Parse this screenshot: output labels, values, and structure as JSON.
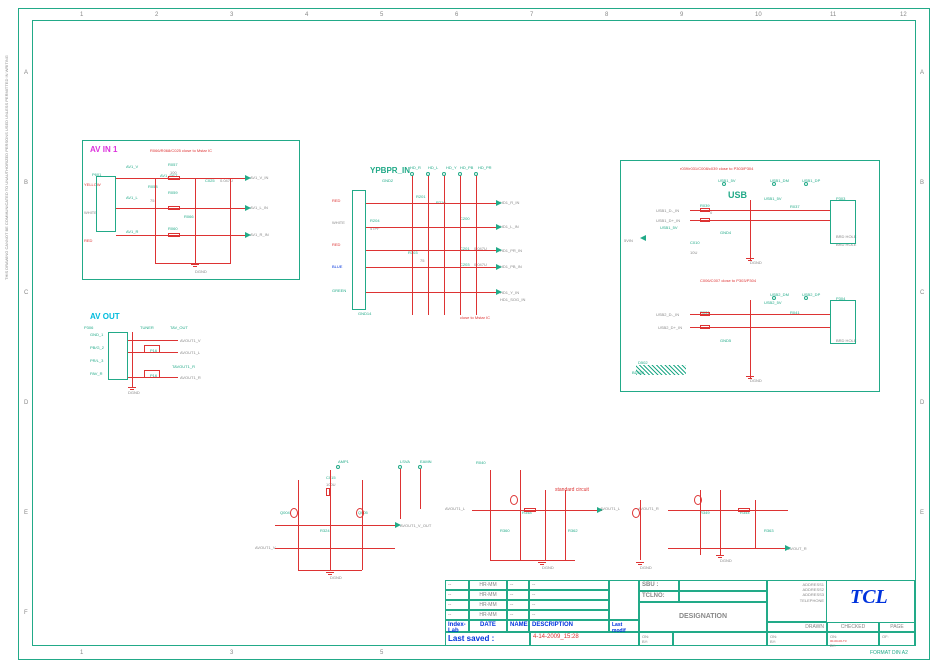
{
  "format": "FORMAT DIN A2",
  "side_notice": "THIS DRAWING CANNOT BE COMMUNICATED TO UNAUTHORIZED PERSONS USED UNLESS PERMITTED IN WRITING",
  "ruler_top": {
    "1": "1",
    "2": "2",
    "3": "3",
    "4": "4",
    "5": "5",
    "6": "6",
    "7": "7",
    "8": "8",
    "9": "9",
    "10": "10",
    "11": "11",
    "12": "12"
  },
  "ruler_side": {
    "A": "A",
    "B": "B",
    "C": "C",
    "D": "D",
    "E": "E",
    "F": "F"
  },
  "blocks": {
    "avin": {
      "title": "AV IN 1",
      "note": "R066/R068/C025 close to Mstar IC",
      "yellow": "YELLOW",
      "white": "WHITE",
      "red": "RED",
      "av1_v": "AV1_V",
      "av1_l": "AV1_L",
      "av1_r": "AV1_R",
      "sig_v": "AV1_V_IN",
      "sig_l": "AV1_L_IN",
      "sig_r": "AV1_R_IN",
      "det": "AV1_DET",
      "dgnd": "DGND",
      "p601": "P601",
      "r057": "R057",
      "r058": "R058",
      "r059": "R059",
      "r060": "R060",
      "r066": "R066",
      "r068": "R068",
      "c025": "C025",
      "v75": "75",
      "v100": "100",
      "v047u": "0.047U",
      "v10u": "10U"
    },
    "avout": {
      "title": "AV OUT",
      "gnd1": "GND_1",
      "pb_g_2": "PB/G_2",
      "pr_l_3": "PR/L_3",
      "pav_r": "PAV_R",
      "tuner": "TUNER",
      "tav_out": "TAV_OUT",
      "tavout1_r": "TAVOUT1_R",
      "avout1_v": "AVOUT1_V",
      "avout1_l": "AVOUT1_L",
      "avout1_r": "AVOUT1_R",
      "p306": "P306",
      "p16": "P16",
      "dgnd": "DGND"
    },
    "ypbpr": {
      "title": "YPBPR_IN",
      "gnd2": "GND2",
      "hd_r": "HD_R",
      "hd_l": "HD_L",
      "hd_y": "HD_Y",
      "hd_pb": "HD_PB",
      "hd_pr": "HD_PR",
      "red": "RED",
      "white": "WHITE",
      "green": "GREEN",
      "blue": "BLUE",
      "hd1_r_in": "HD1_R_IN",
      "hd1_l_in": "HD1_L_IN",
      "hd1_y_in": "HD1_Y_IN",
      "hd1_pb_in": "HD1_PB_IN",
      "hd1_pr_in": "HD1_PR_IN",
      "hd1_sog_in": "HD1_SOG_IN",
      "note": "close to Mstar IC",
      "r201": "R201",
      "r204": "R204",
      "r210": "R210",
      "r216": "R216",
      "r303": "R303",
      "c200": "C200",
      "c201": "C201",
      "c203": "C203",
      "c333": "C333",
      "v75": "75",
      "v100": "100",
      "v47pf": "47PF",
      "v047u": "0.047U",
      "gnd14": "GND14"
    },
    "usb": {
      "title": "USB",
      "note1": "r039/r031/C008/c039 close to P303/P304",
      "note2": "C006/C007 close to P303/P304",
      "usb1_5v": "USB1_5V",
      "usb1_dm": "USB1_DM",
      "usb1_dp": "USB1_DP",
      "usb1_d_in": "USB1_D-_IN",
      "usb1_dp_in": "USB1_D+_IN",
      "usb2_5v": "USB2_5V",
      "usb2_dm": "USB2_DM",
      "usb2_dp": "USB2_DP",
      "usb2_d_in": "USB2_D-_IN",
      "usb2_dp_in": "USB2_D+_IN",
      "gnd4": "GND4",
      "gnd5": "GND5",
      "dgnd": "DGND",
      "brd_hole": "BRD HOLE",
      "p303": "P303",
      "p304": "P304",
      "r039": "R039",
      "r031": "R031",
      "r037": "R037",
      "r041": "R041",
      "c006": "C006",
      "c007": "C007",
      "c008": "C008",
      "c039": "C039",
      "c010": "C010",
      "d502": "D502",
      "bd500": "BD500",
      "v5vin": "5VIN",
      "v0": "0",
      "v4k7": "4.7K",
      "v100nf": "100NF",
      "v10u": "10U"
    },
    "amp": {
      "standard": "standard circuit",
      "avout1_v_out": "AVOUT1_V_OUT",
      "avout1_v": "AVOUT1_V",
      "avout1_l": "AVOUT1_L",
      "avout1_r": "AVOUT1_R",
      "avout_r": "AVOUT_R",
      "amp1": "AMP1",
      "lsva": "LSVA",
      "eamn": "EAMN",
      "q004": "Q004",
      "q005": "Q005",
      "r040": "R040",
      "r344": "R344",
      "r324": "R324",
      "r349": "R349",
      "r360": "R360",
      "r362": "R362",
      "r363": "R363",
      "r348": "R348",
      "c015": "C015",
      "v100": "100",
      "v1k": "1K",
      "v4k7": "4.7K",
      "v12v": "12V",
      "v220u": "220U",
      "v100u": "100U",
      "dgnd": "DGND"
    }
  },
  "title_block": {
    "index_lab": "Index-Lab",
    "date": "DATE",
    "name": "NAME",
    "desc": "DESCRIPTION",
    "last_modif": "Last modif",
    "last_saved_lbl": "Last saved :",
    "last_saved_val": "4-14-2009_15:28",
    "sbu": "SBU :",
    "tclno": "TCLNO:",
    "designation": "DESIGNATION",
    "address": "ADDRESS1\nADDRESS2\nADDRESS3\nTELEPHONE",
    "drawn": "DRAWN",
    "checked": "CHECKED",
    "page": "PAGE",
    "on": "ON:",
    "by": "BY:",
    "on_val": "00-00-00-T3",
    "of": "OF:",
    "hr_mm": "HR-MM",
    "dash": "--",
    "logo": "TCL"
  }
}
